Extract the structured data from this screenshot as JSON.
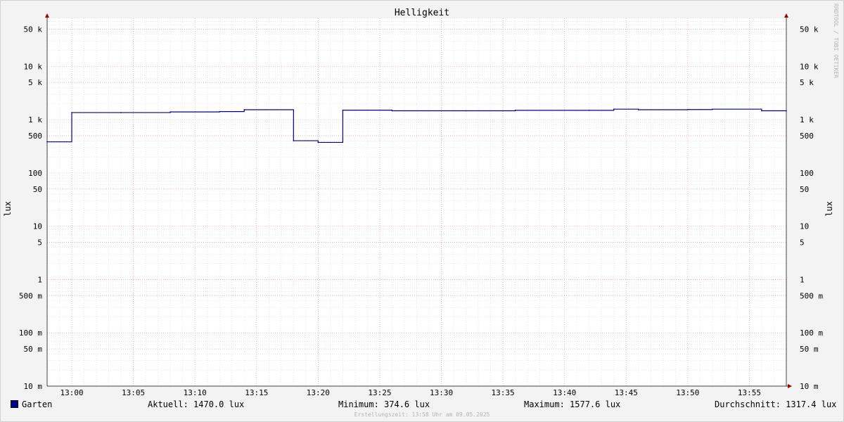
{
  "chart_data": {
    "type": "line",
    "title": "Helligkeit",
    "ylabel": "lux",
    "yscale": "log",
    "ylim": [
      0.01,
      80000
    ],
    "y_ticks": [
      {
        "value": 50000,
        "label": "50 k"
      },
      {
        "value": 10000,
        "label": "10 k"
      },
      {
        "value": 5000,
        "label": "5 k"
      },
      {
        "value": 1000,
        "label": "1 k"
      },
      {
        "value": 500,
        "label": "500"
      },
      {
        "value": 100,
        "label": "100"
      },
      {
        "value": 50,
        "label": "50"
      },
      {
        "value": 10,
        "label": "10"
      },
      {
        "value": 5,
        "label": "5"
      },
      {
        "value": 1,
        "label": "1"
      },
      {
        "value": 0.5,
        "label": "500 m"
      },
      {
        "value": 0.1,
        "label": "100 m"
      },
      {
        "value": 0.05,
        "label": "50 m"
      },
      {
        "value": 0.01,
        "label": "10 m"
      }
    ],
    "x_ticks": [
      "13:00",
      "13:05",
      "13:10",
      "13:15",
      "13:20",
      "13:25",
      "13:30",
      "13:35",
      "13:40",
      "13:45",
      "13:50",
      "13:55"
    ],
    "xlim": [
      "12:58",
      "13:58"
    ],
    "grid": true,
    "series": [
      {
        "name": "Garten",
        "color": "#00008b",
        "step": true,
        "x": [
          "12:58",
          "13:00",
          "13:04",
          "13:08",
          "13:12",
          "13:14",
          "13:18",
          "13:20",
          "13:22",
          "13:26",
          "13:32",
          "13:36",
          "13:42",
          "13:44",
          "13:46",
          "13:50",
          "13:52",
          "13:56",
          "13:58"
        ],
        "values": [
          384,
          1360,
          1360,
          1400,
          1420,
          1540,
          403,
          375,
          1510,
          1470,
          1470,
          1500,
          1500,
          1578,
          1540,
          1550,
          1578,
          1470,
          1470
        ]
      }
    ]
  },
  "legend": {
    "series_name": "Garten",
    "current": "Aktuell: 1470.0 lux",
    "minimum": "Minimum: 374.6 lux",
    "maximum": "Maximum: 1577.6 lux",
    "average": "Durchschnitt: 1317.4 lux"
  },
  "footer": "Erstellungszeit: 13:58 Uhr am 09.05.2025",
  "watermark": "RRDTOOL / TOBI OETIKER"
}
